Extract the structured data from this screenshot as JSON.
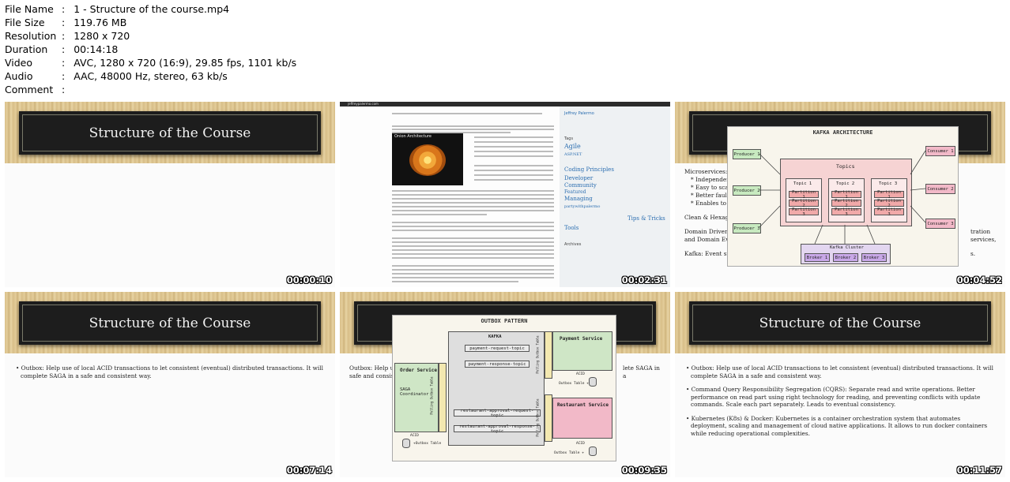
{
  "meta": [
    {
      "key": "File Name",
      "value": "1 - Structure of the course.mp4"
    },
    {
      "key": "File Size",
      "value": "119.76 MB"
    },
    {
      "key": "Resolution",
      "value": "1280 x 720"
    },
    {
      "key": "Duration",
      "value": "00:14:18"
    },
    {
      "key": "Video",
      "value": "AVC, 1280 x 720 (16:9), 29.85 fps, 1101 kb/s"
    },
    {
      "key": "Audio",
      "value": "AAC, 48000 Hz, stereo, 63 kb/s"
    },
    {
      "key": "Comment",
      "value": ""
    }
  ],
  "separator": ":",
  "slide_title": "Structure of the Course",
  "thumbs": [
    {
      "timestamp": "00:00:10"
    },
    {
      "timestamp": "00:02:31"
    },
    {
      "timestamp": "00:04:52"
    },
    {
      "timestamp": "00:07:14"
    },
    {
      "timestamp": "00:09:35"
    },
    {
      "timestamp": "00:11:57"
    }
  ],
  "blog": {
    "url": "jeffreypalermo.com",
    "figure_title": "Onion Architecture",
    "sidebar_name": "Jeffrey Palermo",
    "tags_heading": "Tags",
    "tags": [
      "Agile",
      "ASP.NET",
      "Coding Principles",
      "Community",
      "Developer",
      "Featured",
      "Managing",
      "partywithpalermo",
      "Tips & Tricks",
      "Tools"
    ],
    "archives_heading": "Archives"
  },
  "kafka": {
    "title": "KAFKA ARCHITECTURE",
    "producers": [
      "Producer 1",
      "Producer 2",
      "Producer 3"
    ],
    "consumers": [
      "Consumer 1",
      "Consumer 2",
      "Consumer 3"
    ],
    "topics_label": "Topics",
    "topic_names": [
      "Topic 1",
      "Topic 2",
      "Topic 3"
    ],
    "partitions": [
      "Partition 1",
      "Partition 2",
      "Partition 3"
    ],
    "cluster_label": "Kafka Cluster",
    "brokers": [
      "Broker 1",
      "Broker 2",
      "Broker 3"
    ],
    "bg_bullets": [
      "Microservices: I",
      "* Independent",
      "* Easy to scale",
      "* Better fault i",
      "* Enables to u",
      "Clean & Hexago",
      "Domain Driven",
      "and Domain Ev",
      "Kafka: Event st"
    ],
    "bg_right": [
      "tration services,",
      "s."
    ]
  },
  "outbox": {
    "title": "OUTBOX PATTERN",
    "kafka_label": "KAFKA",
    "topics": [
      "payment-request-topic",
      "payment-response-topic",
      "restaurant-approval-request-topic",
      "restaurant-approval-response-topic"
    ],
    "order_service": "Order Service",
    "saga": "SAGA Coordinator",
    "payment_service": "Payment Service",
    "restaurant_service": "Restaurant Service",
    "polling_table": "Polling Outbox Table",
    "acid": "ACID",
    "outbox_table": "+Outbox Table",
    "outbox_table2": "Outbox Table +",
    "bg_bullets": [
      "Outbox: Help u",
      "safe and consist"
    ],
    "bg_right": "lete SAGA in a"
  },
  "bullets": {
    "outbox": "Outbox: Help use of local ACID transactions to let consistent (eventual) distributed transactions. It will complete SAGA in a safe and consistent way.",
    "cqrs": "Command Query Responsibility Segregation (CQRS): Separate read and write operations. Better performance on read part using right technology for reading, and preventing conflicts with update commands. Scale each part separately. Leads to eventual consistency.",
    "k8s": "Kubernetes (K8s) & Docker: Kubernetes is a container orchestration system that automates deployment, scaling and management of cloud native applications. It allows to run docker containers while reducing operational complexities."
  }
}
